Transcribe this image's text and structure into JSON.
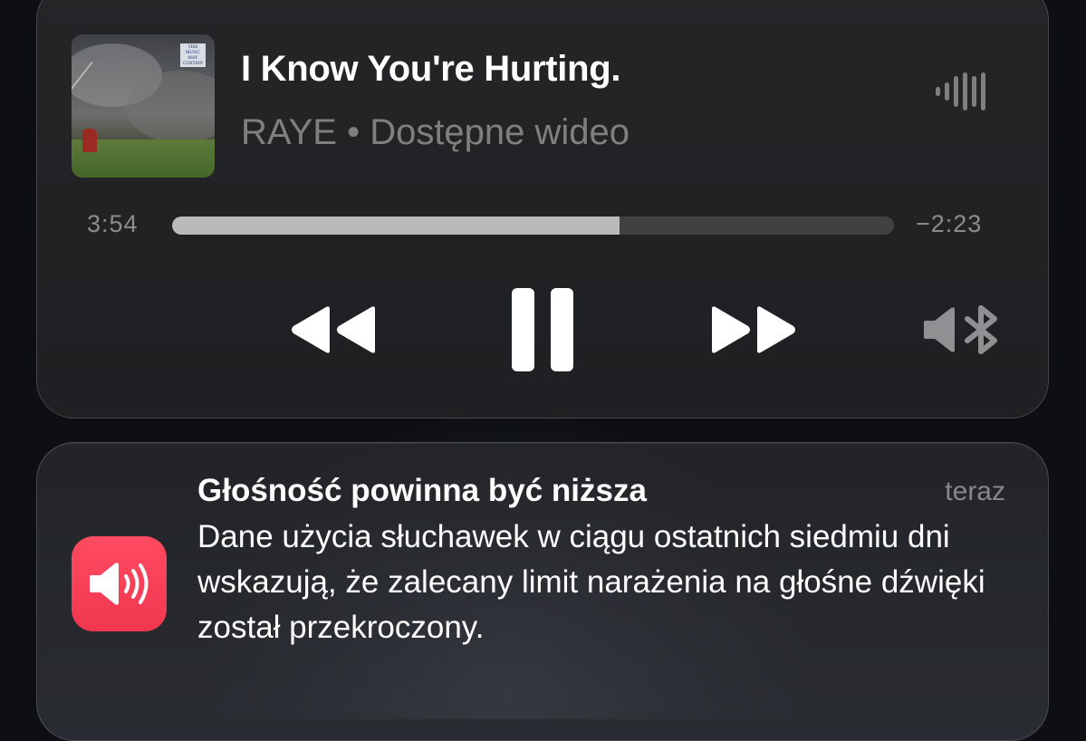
{
  "player": {
    "track_title": "I Know You're Hurting.",
    "subtitle": "RAYE • Dostępne wideo",
    "elapsed": "3:54",
    "remaining": "−2:23",
    "progress_fraction": 0.62,
    "icons": {
      "album_art": "album-art",
      "equalizer": "audio-waveform-icon",
      "rewind": "rewind-icon",
      "pause": "pause-icon",
      "forward": "fast-forward-icon",
      "output": "bluetooth-speaker-icon"
    }
  },
  "notification": {
    "title": "Głośność powinna być niższa",
    "time": "teraz",
    "body": "Dane użycia słuchawek w ciągu ostatnich siedmiu dni wskazują, że zalecany limit narażenia na głośne dźwięki został przekroczony.",
    "icon": "speaker-volume-icon",
    "icon_color": "#f0374f"
  },
  "colors": {
    "card_background": "#232427",
    "accent_red": "#f0374f"
  }
}
